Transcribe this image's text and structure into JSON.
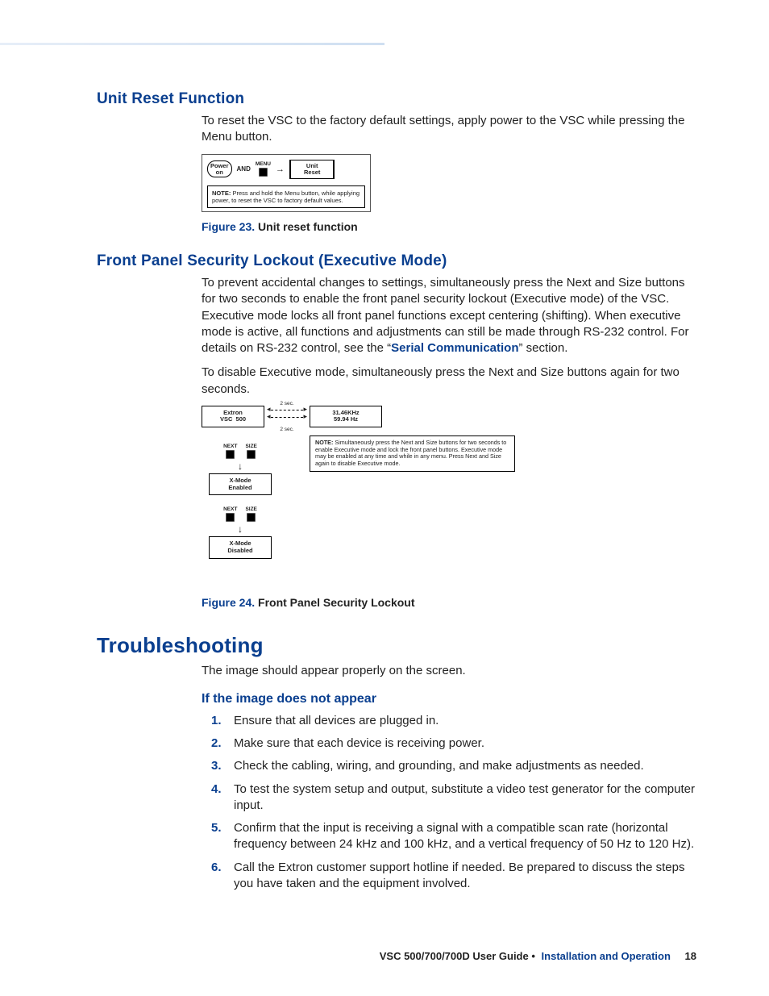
{
  "sections": {
    "unit_reset": {
      "heading": "Unit Reset Function",
      "body": "To reset the VSC to the factory default settings, apply power to the VSC while pressing the Menu button.",
      "fig": {
        "power_label": "Power\non",
        "and": "AND",
        "menu_label": "MENU",
        "unit_reset_label": "Unit\nReset",
        "note_label": "NOTE:",
        "note_text": "Press and hold the Menu button, while applying power, to reset the VSC to factory default values.",
        "caption_num": "Figure 23.",
        "caption_title": "Unit reset function"
      }
    },
    "lockout": {
      "heading": "Front Panel Security Lockout (Executive Mode)",
      "p1_a": "To prevent accidental changes to settings, simultaneously press the Next and Size buttons for two seconds to enable the front panel security lockout (Executive mode) of the VSC. Executive mode locks all front panel functions except centering (shifting). When executive mode is active, all functions and adjustments can still be made through RS-232 control. For details on RS-232 control, see the “",
      "p1_link": "Serial Communication",
      "p1_b": "” section.",
      "p2": "To disable Executive mode, simultaneously press the Next and Size buttons again for two seconds.",
      "fig": {
        "lcd_left": "Extron\nVSC  500",
        "lcd_right": "31.46KHz\n59.94 Hz",
        "sec_label": "2 sec.",
        "next_label": "NEXT",
        "size_label": "SIZE",
        "state_enabled": "X-Mode\nEnabled",
        "state_disabled": "X-Mode\nDisabled",
        "note_label": "NOTE:",
        "note_text": "Simultaneously press the Next and Size buttons for two seconds to enable Executive mode and lock the front panel buttons. Executive mode may be enabled at any time and while in any menu. Press Next and Size again to disable Executive mode.",
        "caption_num": "Figure 24.",
        "caption_title": "Front Panel Security Lockout"
      }
    },
    "troubleshooting": {
      "heading": "Troubleshooting",
      "intro": "The image should appear properly on the screen.",
      "sub": "If the image does not appear",
      "steps": [
        "Ensure that all devices are plugged in.",
        "Make sure that each device is receiving power.",
        "Check the cabling, wiring, and grounding, and make adjustments as needed.",
        "To test the system setup and output, substitute a video test generator for the computer input.",
        "Confirm that the input is receiving a signal with a compatible scan rate (horizontal frequency between 24 kHz and 100 kHz, and a vertical frequency of 50 Hz to 120 Hz).",
        "Call the Extron customer support hotline if needed.  Be prepared to discuss the steps you have taken and the equipment involved."
      ]
    }
  },
  "footer": {
    "doc": "VSC 500/700/700D User Guide",
    "bullet": "•",
    "section": "Installation and Operation",
    "page": "18"
  }
}
